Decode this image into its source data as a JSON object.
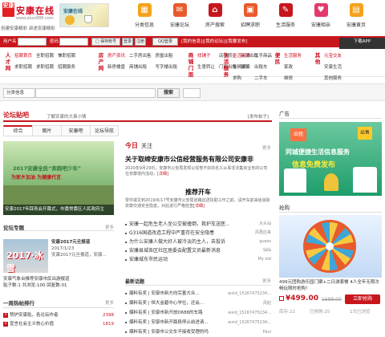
{
  "header": {
    "logo_mark": "安康",
    "logo_text": "安康在线",
    "logo_url": "www.akzx888.com",
    "slogan": "创建安康精彩 讲述安康精彩",
    "banner_text": "安康在线",
    "nav": [
      {
        "label": "分类信息",
        "icon": "grid-icon",
        "color": "#f4a21c"
      },
      {
        "label": "安康论坛",
        "icon": "chat-icon",
        "color": "#e85b2c"
      },
      {
        "label": "房产搜索",
        "icon": "house-icon",
        "color": "#c8161d"
      },
      {
        "label": "招聘求职",
        "icon": "briefcase-icon",
        "color": "#e85b2c"
      },
      {
        "label": "生活服务",
        "icon": "wrench-icon",
        "color": "#c8161d"
      },
      {
        "label": "安康相亲",
        "icon": "heart-icon",
        "color": "#e23a6b"
      },
      {
        "label": "安康黄页",
        "icon": "book-icon",
        "color": "#f4a21c"
      }
    ]
  },
  "loginbar": {
    "user_label": "用户名",
    "pass_label": "密码",
    "save_label": "□ 保存账号",
    "login_btn": "登录",
    "register_btn": "注册",
    "qq_login": "QQ登录",
    "app_download": "下载APP",
    "links": "[我的信息]|[我的论坛]|[我要发布]"
  },
  "categories": [
    {
      "title": "人才网",
      "items": [
        "招聘首页",
        "全职招聘",
        "兼职招聘",
        "求职招聘",
        "求职招聘",
        "招聘服务"
      ]
    },
    {
      "title": "房产网",
      "items": [
        "房产资讯",
        "二手房出售",
        "房屋出租",
        "新房楼盘",
        "商铺出租",
        "写字楼出租"
      ]
    },
    {
      "title": "商铺门面",
      "items": [
        "找铺子",
        "店铺转让",
        "商铺出租",
        "生意转让",
        "门面出租",
        "铺转"
      ]
    },
    {
      "title": "生活服务",
      "items": [
        "生活买卖",
        "二手商品",
        "车辆买卖",
        "出租车",
        "求购",
        "二手车"
      ]
    },
    {
      "title": "便民",
      "items": [
        "生活服务",
        "家政",
        "维修",
        "保洁"
      ]
    },
    {
      "title": "其他",
      "items": [
        "元宝交友",
        "安康生活",
        "其他服务",
        "安康相亲"
      ]
    }
  ],
  "search": {
    "select": "分类信息",
    "button": "搜索"
  },
  "forum": {
    "title": "论坛贴吧",
    "sub": "了解安康的大事小情",
    "more": "[发布帖子]",
    "tabs": [
      "综合",
      "图片",
      "安康吧",
      "论坛导航"
    ],
    "big_image_title": "2017安康全民“奔跑吧少年”",
    "big_image_sub": "为家乡加油 为健康代言",
    "big_image_caption": "安康2017年踩青会开幕式，市委常委区人民政府主",
    "rec_title": "论坛专题",
    "rec_more": "更多",
    "rec_img_text": "2017·冰雪",
    "rec_head": "安康2017元旦报道",
    "rec_date": "2017/1/23",
    "rec_desc": "安康2017元旦报道，安康...",
    "rec_foot1": "安康气象台推荐安康市民出游报道",
    "rec_foot2": "贴子数:1 共浏览:100 回复数:01",
    "hot_title": "一周热帖排行",
    "hot_more": "更多",
    "hot": [
      {
        "rank": "1",
        "text": "赞护安康贴，各论坛作者",
        "num": "2398"
      },
      {
        "rank": "2",
        "text": "宣言社会主义核心价值",
        "num": "1819"
      }
    ]
  },
  "middle": {
    "today_a": "今日",
    "today_b": "关注",
    "more": "更多",
    "headline": "关于取缔安康市公信经营服务有限公司安康非",
    "headline_sub": "2020年9月29日，安康市公安局发现以信誉不好的名义从事非法集资业务的公司在安康境内活动，",
    "headline_link": "[详细]",
    "h2": "推荐开车",
    "h2_sub": "零件或见到2019/6/17号安康市公安局道路巡逻执勤工作之前，请开车前来给消除安康交通安全隐患，对此进行严格检查",
    "h2_link": "[详细]",
    "news": [
      {
        "text": "安康一起危生老人坐公交被撞倒，救护车送医...",
        "user": "大头仙"
      },
      {
        "text": "G316国道改造工程中严重存在安全隐患",
        "user": "风再应来"
      },
      {
        "text": "为什么安康人做大好人被冷淡的主人，去投诉",
        "user": "guess"
      },
      {
        "text": "安康县城各区社区居委会配置文员最新消息",
        "user": "仙仙"
      },
      {
        "text": "安康城东市民运动",
        "user": "My old"
      }
    ],
    "latest_title": "最新话题",
    "latest_more": "更多",
    "latest": [
      {
        "tag": "爆料有奖",
        "text": "安康市新方向完善大众...",
        "user": "wxid_15267475234..."
      },
      {
        "tag": "爆料有奖",
        "text": "恒大金碧中心学位，还会...",
        "user": "风妃"
      },
      {
        "tag": "爆料有奖",
        "text": "安康市新开放D688的车路",
        "user": "wxid_15267475234..."
      },
      {
        "tag": "爆料有奖",
        "text": "安康市新开路段停止前进请...",
        "user": "wxid_15267475234..."
      },
      {
        "tag": "爆料有奖",
        "text": "安康市公交车不接收受理的吗",
        "user": "Paul"
      }
    ]
  },
  "right": {
    "ad_title": "广告",
    "ad_line1": "同城便捷生活信息服务",
    "ad_line2": "信息免费发布",
    "ad_tag1": "出租",
    "ad_tag2": "出售",
    "group_title": "抢购",
    "group_desc": "499元团购游乐园门票+二日游套餐 4人全年无限次畅玩限时抢购！",
    "price": "¥499.00",
    "old_price": "1688.00",
    "buy_btn": "立即抢购",
    "stat1": "库存:22",
    "stat2": "已抢购:25",
    "stat3": "1次已浏览"
  }
}
